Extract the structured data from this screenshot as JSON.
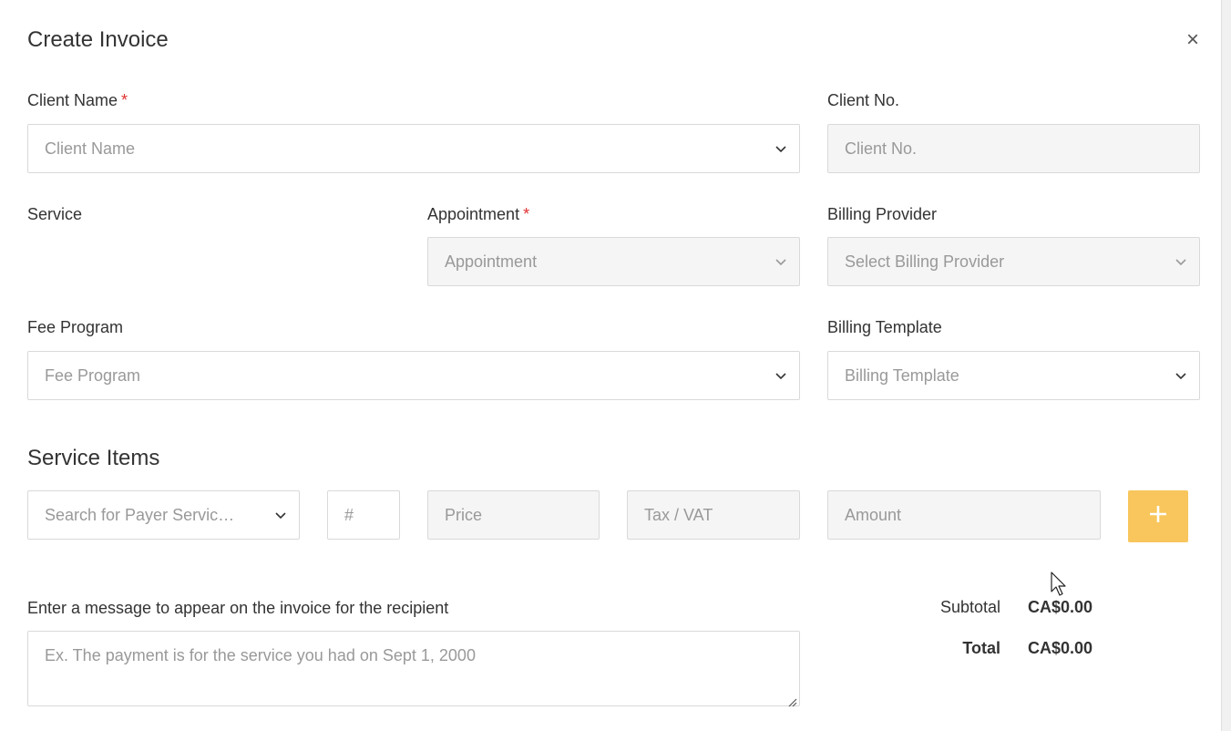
{
  "modal": {
    "title": "Create Invoice",
    "close_glyph": "×"
  },
  "form": {
    "client_name": {
      "label": "Client Name",
      "required_mark": "*",
      "placeholder": "Client Name"
    },
    "client_no": {
      "label": "Client No.",
      "placeholder": "Client No."
    },
    "service": {
      "label": "Service"
    },
    "appointment": {
      "label": "Appointment",
      "required_mark": "*",
      "placeholder": "Appointment"
    },
    "billing_provider": {
      "label": "Billing Provider",
      "placeholder": "Select Billing Provider"
    },
    "fee_program": {
      "label": "Fee Program",
      "placeholder": "Fee Program"
    },
    "billing_template": {
      "label": "Billing Template",
      "placeholder": "Billing Template"
    }
  },
  "service_items": {
    "heading": "Service Items",
    "search_placeholder": "Search for Payer Servic…",
    "qty_placeholder": "#",
    "price_placeholder": "Price",
    "tax_placeholder": "Tax / VAT",
    "amount_placeholder": "Amount",
    "add_button_icon": "plus-icon"
  },
  "message": {
    "label": "Enter a message to appear on the invoice for the recipient",
    "placeholder": "Ex. The payment is for the service you had on Sept 1, 2000"
  },
  "totals": {
    "subtotal_label": "Subtotal",
    "subtotal_value": "CA$0.00",
    "total_label": "Total",
    "total_value": "CA$0.00"
  },
  "colors": {
    "accent_button": "#f8c65c",
    "required": "#e03131",
    "disabled_field_bg": "#f5f5f5"
  }
}
